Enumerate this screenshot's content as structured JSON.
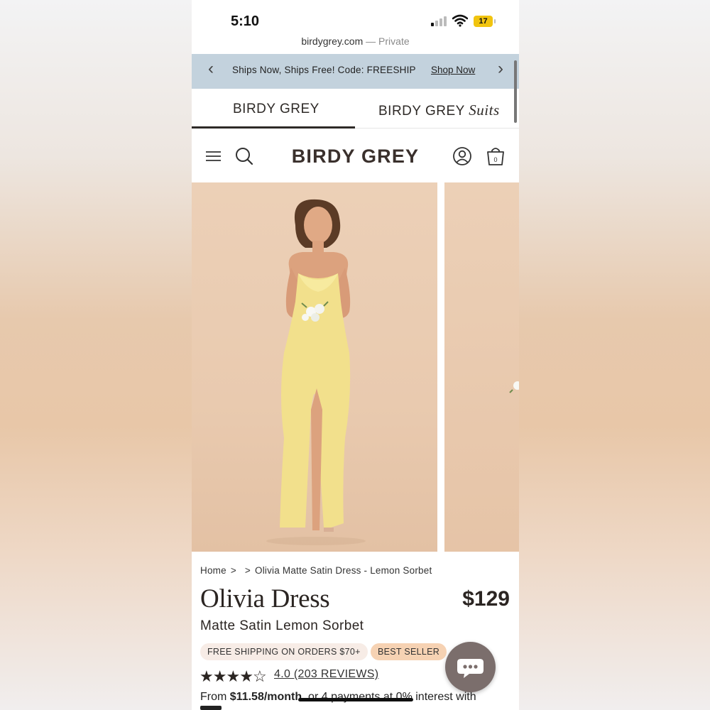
{
  "status_bar": {
    "time": "5:10",
    "battery": "17"
  },
  "browser": {
    "domain": "birdygrey.com",
    "separator": " — ",
    "mode": "Private"
  },
  "promo": {
    "text": "Ships Now, Ships Free! Code: FREESHIP",
    "link": "Shop Now"
  },
  "brand_tabs": [
    {
      "label": "BIRDY GREY",
      "active": true
    },
    {
      "label": "BIRDY GREY",
      "suffix": "Suits",
      "active": false
    }
  ],
  "header": {
    "logo": "BIRDY GREY",
    "cart_count": "0"
  },
  "breadcrumb": {
    "home": "Home",
    "sep1": ">",
    "sep2": ">",
    "current": "Olivia Matte Satin Dress - Lemon Sorbet"
  },
  "product": {
    "title": "Olivia Dress",
    "price": "$129",
    "subtitle": "Matte Satin Lemon Sorbet",
    "badges": {
      "shipping": "FREE SHIPPING ON ORDERS $70+",
      "best": "BEST SELLER"
    },
    "rating": {
      "stars": 4,
      "of": 5,
      "label": "4.0 (203 REVIEWS)"
    },
    "installment": {
      "prefix": "From ",
      "amount": "$11.58/month",
      "rest": ", or 4 payments at 0% interest with"
    }
  },
  "colors": {
    "promo_bg": "#c3d2dd",
    "badge_best": "#f6d2b3",
    "badge_ship": "#f7ece6",
    "chat_bg": "#7b6e6c",
    "dress": "#f2e08c"
  }
}
